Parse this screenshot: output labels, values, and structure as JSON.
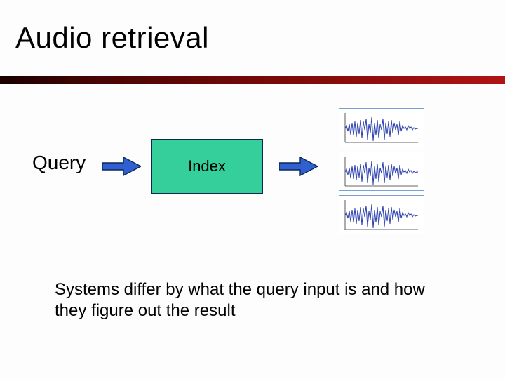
{
  "title": "Audio retrieval",
  "query_label": "Query",
  "index_label": "Index",
  "caption": "Systems differ by what the query input is and how they figure out the result",
  "colors": {
    "arrow_fill": "#2f5fd0",
    "arrow_stroke": "#0a2a52",
    "index_fill": "#34cf9a",
    "rule_gradient": [
      "#1a0000",
      "#4a0404",
      "#7a0909",
      "#b01414"
    ]
  }
}
